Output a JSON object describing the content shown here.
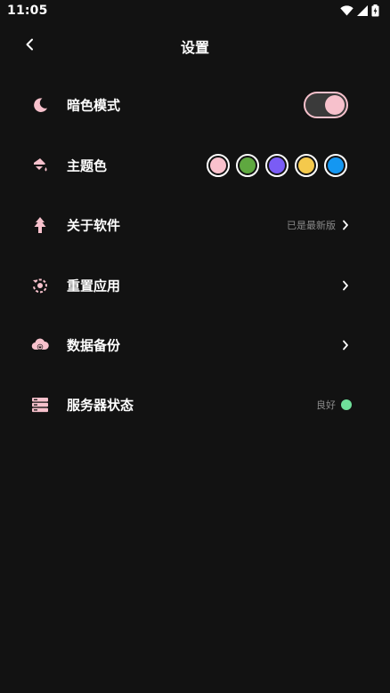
{
  "status_bar": {
    "time": "11:05",
    "icons": [
      "wifi-icon",
      "cellular-signal-icon",
      "battery-charging-icon"
    ]
  },
  "header": {
    "title": "设置",
    "back_icon": "chevron-left-icon"
  },
  "settings": {
    "dark_mode": {
      "label": "暗色模式",
      "icon": "moon-icon",
      "enabled": true
    },
    "theme_color": {
      "label": "主题色",
      "icon": "paint-bucket-icon",
      "options": [
        "#f9c1cc",
        "#5fa840",
        "#7a5cf5",
        "#f4c94c",
        "#1497f2"
      ],
      "selected_index": 0
    },
    "about": {
      "label": "关于软件",
      "icon": "tree-icon",
      "status": "已是最新版"
    },
    "reset": {
      "label": "重置应用",
      "icon": "reset-icon"
    },
    "backup": {
      "label": "数据备份",
      "icon": "cloud-backup-icon"
    },
    "server_status": {
      "label": "服务器状态",
      "icon": "server-icon",
      "status": "良好",
      "status_color": "#6fe09a"
    }
  },
  "colors": {
    "accent": "#f7c1cc",
    "background": "#121212",
    "secondary_text": "#8a8a8a"
  }
}
